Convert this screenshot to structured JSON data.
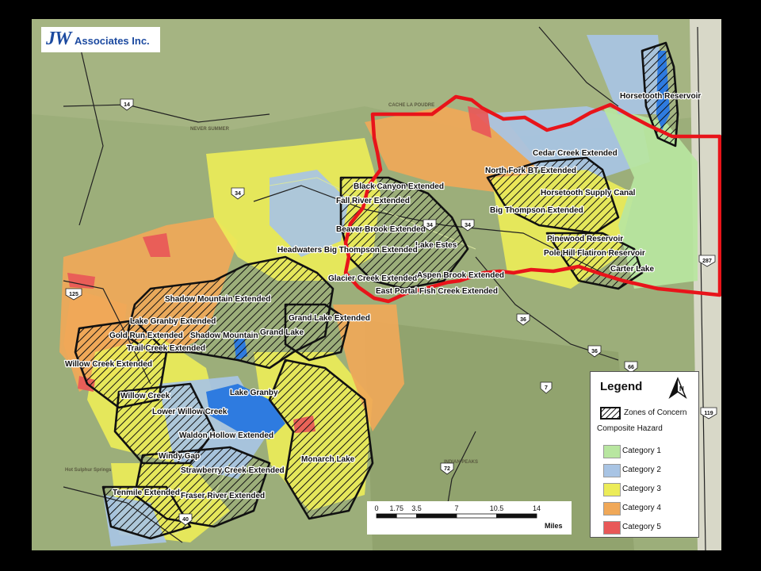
{
  "logo": {
    "initials": "JW",
    "rest": "Associates Inc."
  },
  "colors": {
    "category1": "#b8e6a0",
    "category2": "#a8c4e4",
    "category3": "#ecec58",
    "category4": "#f0a858",
    "category5": "#e85858",
    "concern_outline": "#111111",
    "study_boundary": "#e8141a",
    "reservoir": "#2e7be0",
    "terrain": "#9cae7a"
  },
  "legend": {
    "title": "Legend",
    "zones_of_concern": "Zones of Concern",
    "composite_hazard": "Composite Hazard",
    "categories": [
      {
        "label": "Category 1",
        "color": "#b8e6a0"
      },
      {
        "label": "Category 2",
        "color": "#a8c4e4"
      },
      {
        "label": "Category 3",
        "color": "#ecec58"
      },
      {
        "label": "Category 4",
        "color": "#f0a858"
      },
      {
        "label": "Category 5",
        "color": "#e85858"
      }
    ],
    "north_icon": "north-arrow-icon"
  },
  "scale_bar": {
    "ticks": [
      "0",
      "1.75",
      "3.5",
      "7",
      "10.5",
      "14"
    ],
    "tick_values": [
      0,
      1.75,
      3.5,
      7,
      10.5,
      14
    ],
    "units": "Miles"
  },
  "zone_labels": [
    "Horsetooth Reservoir",
    "Cedar Creek Extended",
    "North Fork BT Extended",
    "Horsetooth Supply Canal",
    "Big Thompson Extended",
    "Black Canyon Extended",
    "Fall River Extended",
    "Beaver Brook Extended",
    "Lake Estes",
    "Pinewood Reservoir",
    "Pole Hill Flatiron Reservoir",
    "Carter Lake",
    "Headwaters Big Thompson Extended",
    "Glacier Creek Extended",
    "Aspen Brook Extended",
    "East Portal Fish Creek Extended",
    "Shadow Mountain Extended",
    "Lake Granby Extended",
    "Grand Lake Extended",
    "Gold Run Extended",
    "Shadow Mountain",
    "Grand Lake",
    "Trail Creek Extended",
    "Willow Creek Extended",
    "Willow Creek",
    "Lake Granby",
    "Lower Willow Creek",
    "Waldon Hollow Extended",
    "Windy Gap",
    "Strawberry Creek Extended",
    "Monarch Lake",
    "Tenmile Extended",
    "Fraser River Extended"
  ],
  "highway_shields": [
    "14",
    "34",
    "34",
    "34",
    "125",
    "36",
    "36",
    "7",
    "72",
    "40",
    "287",
    "119",
    "66"
  ],
  "map_text": [
    "Hot Sulphur Springs"
  ]
}
